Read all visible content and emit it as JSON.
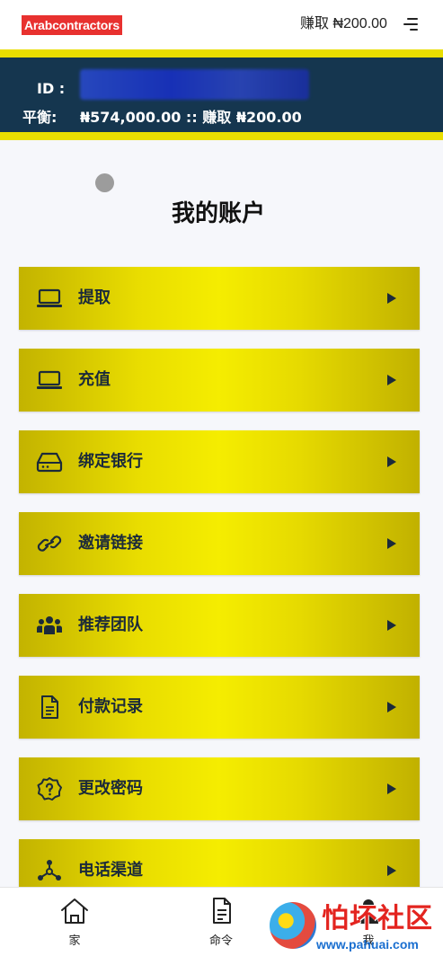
{
  "header": {
    "logo_text": "Arabcontractors",
    "earn_text": "赚取 ₦200.00",
    "menu_icon": "hamburger-menu-icon"
  },
  "banner": {
    "id_label": "ID :",
    "balance_label": "平衡:",
    "balance_text": "₦574,000.00 :: 赚取 ₦200.00"
  },
  "main": {
    "title": "我的账户",
    "menu_items": [
      {
        "label": "提取",
        "icon": "laptop-icon"
      },
      {
        "label": "充值",
        "icon": "laptop-icon"
      },
      {
        "label": "绑定银行",
        "icon": "hard-drive-icon"
      },
      {
        "label": "邀请链接",
        "icon": "link-icon"
      },
      {
        "label": "推荐团队",
        "icon": "people-group-icon"
      },
      {
        "label": "付款记录",
        "icon": "document-icon"
      },
      {
        "label": "更改密码",
        "icon": "question-badge-icon"
      },
      {
        "label": "电话渠道",
        "icon": "network-hub-icon"
      }
    ]
  },
  "bottom_nav": {
    "items": [
      {
        "label": "家",
        "icon": "home-icon"
      },
      {
        "label": "命令",
        "icon": "order-document-icon"
      },
      {
        "label": "我",
        "icon": "user-icon"
      }
    ]
  },
  "watermark": {
    "text": "怕坏社区",
    "url": "www.pahuai.com"
  },
  "colors": {
    "banner_bg": "#15364f",
    "banner_border": "#e9de00",
    "menu_gold": "#f5ed00",
    "logo_red": "#e8312f"
  }
}
